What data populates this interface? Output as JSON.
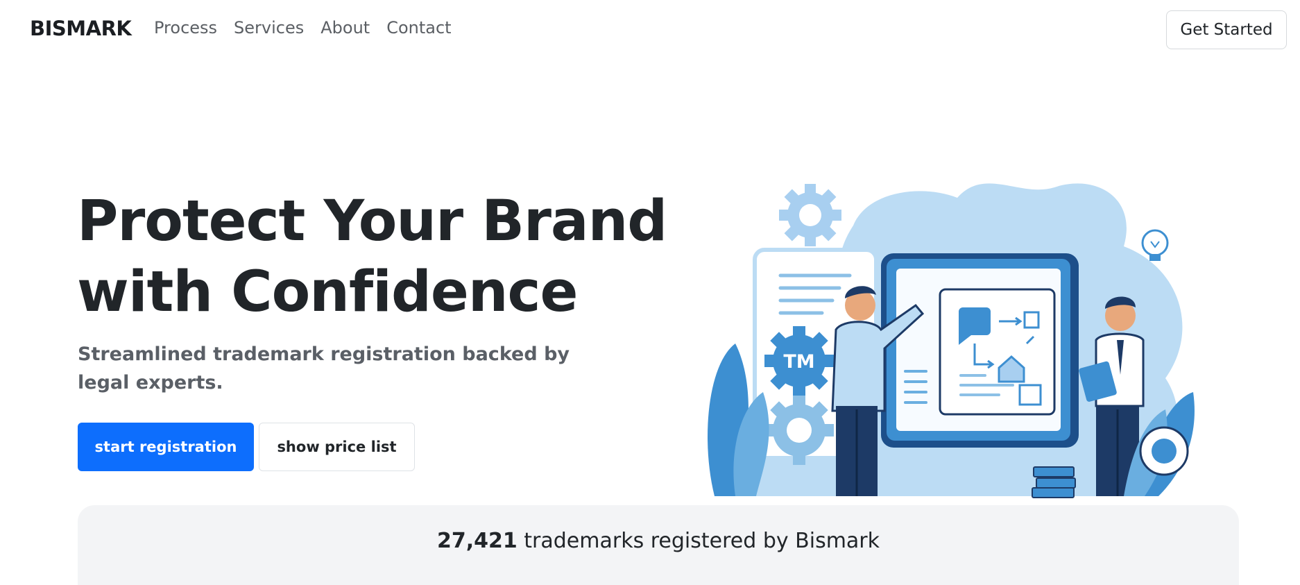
{
  "nav": {
    "logo": "BISMARK",
    "links": [
      "Process",
      "Services",
      "About",
      "Contact"
    ],
    "cta": "Get Started"
  },
  "hero": {
    "title_line1": "Protect Your Brand",
    "title_line2": "with Confidence",
    "subtitle": "Streamlined trademark registration backed by legal experts.",
    "primary_button": "start registration",
    "secondary_button": "show price list",
    "illustration_badge": "TM"
  },
  "stats": {
    "count": "27,421",
    "text": " trademarks registered by Bismark"
  },
  "colors": {
    "primary": "#0d6efd",
    "text_dark": "#212529",
    "illustration_blue": "#3d8fd1",
    "illustration_light": "#bcdcf4",
    "illustration_navy": "#1d3a66",
    "stats_bg": "#f3f4f6"
  }
}
